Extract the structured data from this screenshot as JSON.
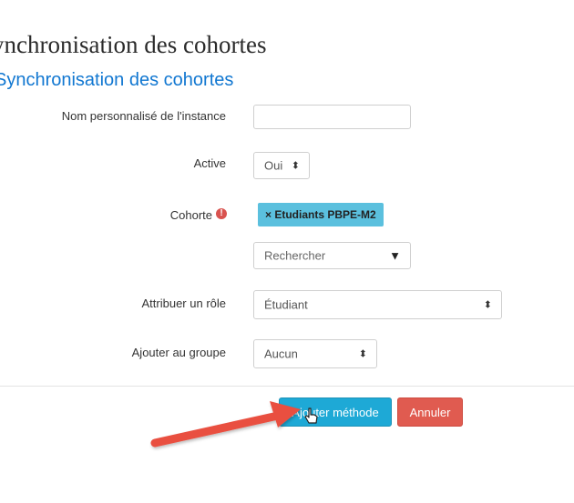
{
  "page": {
    "title": "Synchronisation des cohortes",
    "section_title": "Synchronisation des cohortes"
  },
  "form": {
    "instance_name": {
      "label": "Nom personnalisé de l'instance",
      "value": ""
    },
    "active": {
      "label": "Active",
      "value": "Oui"
    },
    "cohort": {
      "label": "Cohorte",
      "required_icon": "exclamation-icon",
      "selected_tag": "× Etudiants PBPE-M2",
      "search_placeholder": "Rechercher"
    },
    "role": {
      "label": "Attribuer un rôle",
      "value": "Étudiant"
    },
    "group": {
      "label": "Ajouter au groupe",
      "value": "Aucun"
    }
  },
  "buttons": {
    "submit": "Ajouter méthode",
    "cancel": "Annuler"
  },
  "colors": {
    "heading_blue": "#1177d1",
    "tag_bg": "#5bc0de",
    "primary": "#1ea9d6",
    "danger": "#e05b50",
    "annotation_arrow": "#e94f3f"
  },
  "icons": {
    "select_arrows": "⇕",
    "dropdown_triangle": "▼",
    "warning": "!"
  }
}
